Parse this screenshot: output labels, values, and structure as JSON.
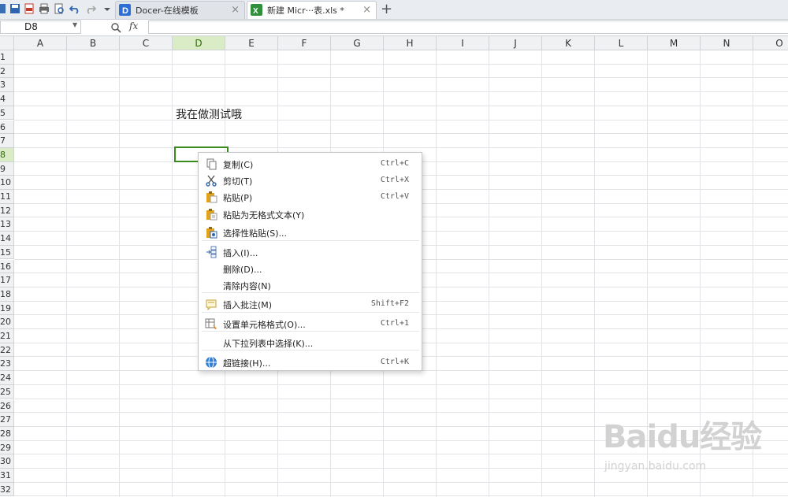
{
  "tabs": [
    {
      "label": "Docer-在线模板",
      "close": "×"
    },
    {
      "label": "新建 Micr···表.xls *",
      "close": "×"
    }
  ],
  "tab_add": "+",
  "formula_bar": {
    "name_box": "D8",
    "fx": "fx",
    "value": ""
  },
  "columns": [
    "A",
    "B",
    "C",
    "D",
    "E",
    "F",
    "G",
    "H",
    "I",
    "J",
    "K",
    "L",
    "M",
    "N",
    "O"
  ],
  "selected_column": "D",
  "rows": [
    "1",
    "2",
    "3",
    "4",
    "5",
    "6",
    "7",
    "8",
    "9",
    "10",
    "11",
    "12",
    "13",
    "14",
    "15",
    "16",
    "17",
    "18",
    "19",
    "20",
    "21",
    "22",
    "23",
    "24",
    "25",
    "26",
    "27",
    "28",
    "29",
    "30",
    "31",
    "32"
  ],
  "selected_row": "8",
  "cells": {
    "D5": "我在做测试哦"
  },
  "context_menu": {
    "items": [
      {
        "label": "复制(C)",
        "shortcut": "Ctrl+C",
        "icon": "copy-icon"
      },
      {
        "label": "剪切(T)",
        "shortcut": "Ctrl+X",
        "icon": "scissors-icon"
      },
      {
        "label": "粘贴(P)",
        "shortcut": "Ctrl+V",
        "icon": "paste-icon"
      },
      {
        "label": "粘贴为无格式文本(Y)",
        "shortcut": "",
        "icon": "paste-plain-icon"
      },
      {
        "label": "选择性粘贴(S)...",
        "shortcut": "",
        "icon": "paste-special-icon"
      },
      {
        "label": "插入(I)...",
        "shortcut": "",
        "icon": "insert-icon"
      },
      {
        "label": "删除(D)...",
        "shortcut": "",
        "icon": ""
      },
      {
        "label": "清除内容(N)",
        "shortcut": "",
        "icon": ""
      },
      {
        "label": "插入批注(M)",
        "shortcut": "Shift+F2",
        "icon": "comment-icon"
      },
      {
        "label": "设置单元格格式(O)...",
        "shortcut": "Ctrl+1",
        "icon": "format-cells-icon"
      },
      {
        "label": "从下拉列表中选择(K)...",
        "shortcut": "",
        "icon": ""
      },
      {
        "label": "超链接(H)...",
        "shortcut": "Ctrl+K",
        "icon": "hyperlink-icon"
      }
    ]
  },
  "watermark": {
    "main": "Baidu经验",
    "sub": "jingyan.baidu.com"
  },
  "colors": {
    "selection_green": "#3a8a1c",
    "header_selected": "#d9ecc5"
  }
}
